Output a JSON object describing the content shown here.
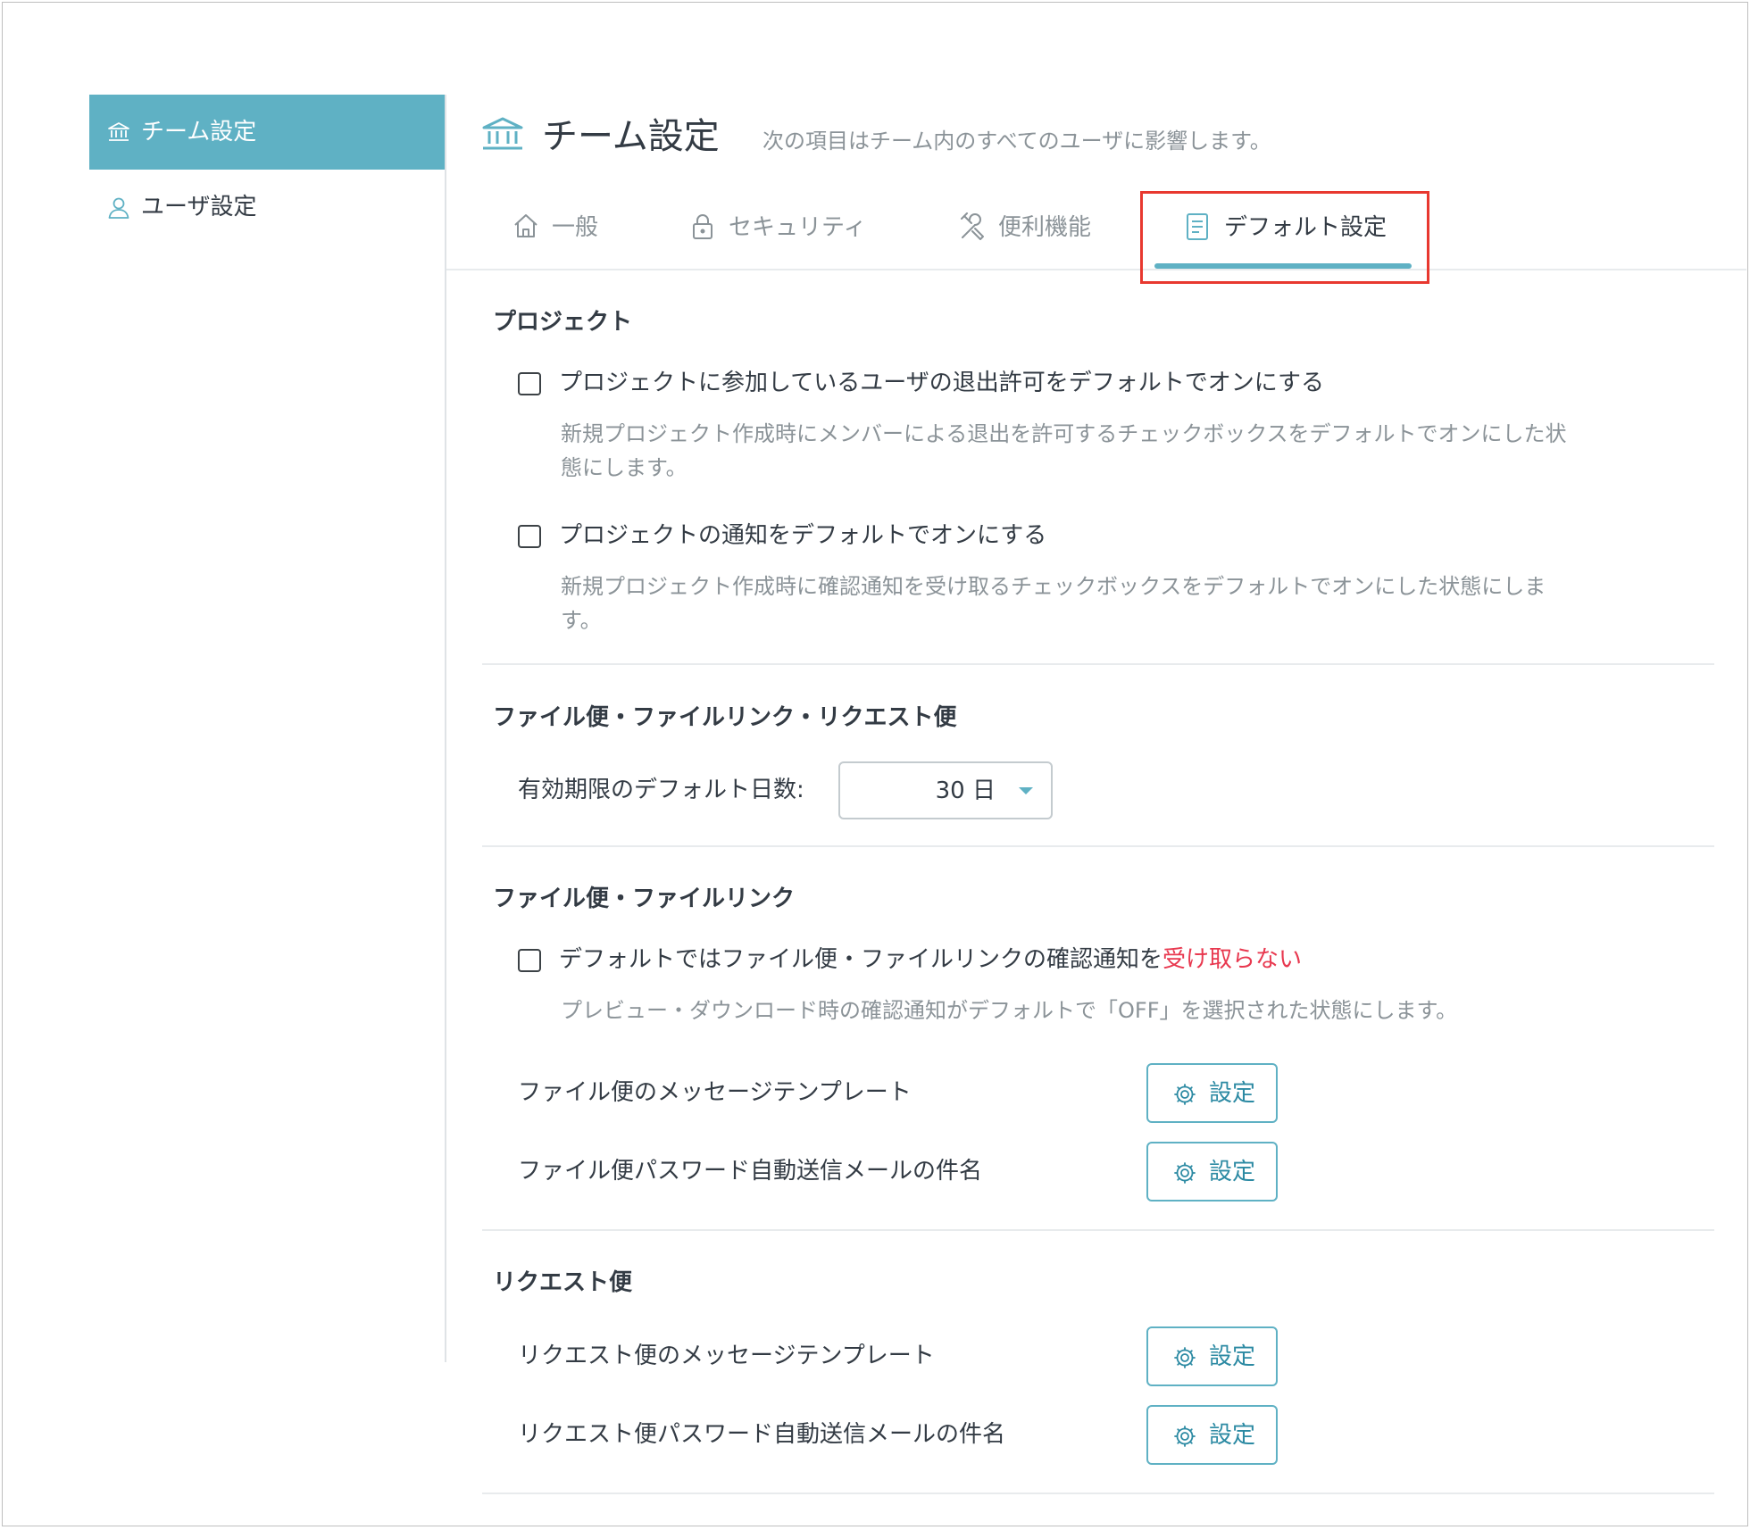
{
  "sidebar": {
    "items": [
      {
        "label": "チーム設定",
        "icon": "bank-icon",
        "active": true
      },
      {
        "label": "ユーザ設定",
        "icon": "user-icon",
        "active": false
      }
    ]
  },
  "header": {
    "title": "チーム設定",
    "subtitle": "次の項目はチーム内のすべてのユーザに影響します。"
  },
  "tabs": [
    {
      "label": "一般",
      "icon": "home-icon"
    },
    {
      "label": "セキュリティ",
      "icon": "lock-icon"
    },
    {
      "label": "便利機能",
      "icon": "tools-icon"
    },
    {
      "label": "デフォルト設定",
      "icon": "document-icon",
      "active": true
    }
  ],
  "sections": {
    "project": {
      "title": "プロジェクト",
      "option1": {
        "label": "プロジェクトに参加しているユーザの退出許可をデフォルトでオンにする",
        "checked": false,
        "description": "新規プロジェクト作成時にメンバーによる退出を許可するチェックボックスをデフォルトでオンにした状態にします。"
      },
      "option2": {
        "label": "プロジェクトの通知をデフォルトでオンにする",
        "checked": false,
        "description": "新規プロジェクト作成時に確認通知を受け取るチェックボックスをデフォルトでオンにした状態にします。"
      }
    },
    "expiry": {
      "title": "ファイル便・ファイルリンク・リクエスト便",
      "label": "有効期限のデフォルト日数:",
      "value": "30 日"
    },
    "file": {
      "title": "ファイル便・ファイルリンク",
      "notify": {
        "label_prefix": "デフォルトではファイル便・ファイルリンクの確認通知を",
        "label_emphasis": "受け取らない",
        "checked": false,
        "description": "プレビュー・ダウンロード時の確認通知がデフォルトで「OFF」を選択された状態にします。"
      },
      "message_template": {
        "label": "ファイル便のメッセージテンプレート",
        "button": "設定"
      },
      "password_subject": {
        "label": "ファイル便パスワード自動送信メールの件名",
        "button": "設定"
      }
    },
    "request": {
      "title": "リクエスト便",
      "message_template": {
        "label": "リクエスト便のメッセージテンプレート",
        "button": "設定"
      },
      "password_subject": {
        "label": "リクエスト便パスワード自動送信メールの件名",
        "button": "設定"
      }
    }
  },
  "colors": {
    "accent": "#5fb1c4",
    "emphasis_red": "#e8384f",
    "highlight_box": "#e8382f",
    "text": "#333b44",
    "muted_text": "#8b9398"
  }
}
